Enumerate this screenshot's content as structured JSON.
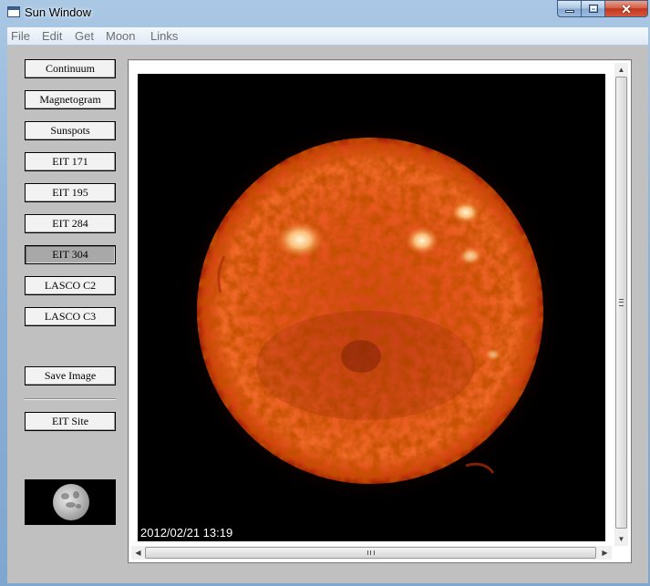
{
  "window": {
    "title": "Sun Window"
  },
  "menu": [
    "File",
    "Edit",
    "Get",
    "Moon",
    "Links"
  ],
  "buttons": [
    {
      "label": "Continuum",
      "pressed": false
    },
    {
      "label": "Magnetogram",
      "pressed": false
    },
    {
      "label": "Sunspots",
      "pressed": false
    },
    {
      "label": "EIT 171",
      "pressed": false
    },
    {
      "label": "EIT 195",
      "pressed": false
    },
    {
      "label": "EIT 284",
      "pressed": false
    },
    {
      "label": "EIT 304",
      "pressed": true
    },
    {
      "label": "LASCO C2",
      "pressed": false
    },
    {
      "label": "LASCO C3",
      "pressed": false
    }
  ],
  "save_image_label": "Save Image",
  "eit_site_label": "EIT Site",
  "viewer": {
    "timestamp": "2012/02/21 13:19"
  },
  "icons": {
    "app": "window-icon",
    "minimize": "minimize-icon",
    "maximize": "maximize-icon",
    "close": "close-icon",
    "moon_phase": "moon-phase-image"
  },
  "colors": {
    "sun_core": "#e8541a",
    "sun_edge": "#8a1204",
    "active_region": "#ffe8b8",
    "background": "#000000"
  }
}
